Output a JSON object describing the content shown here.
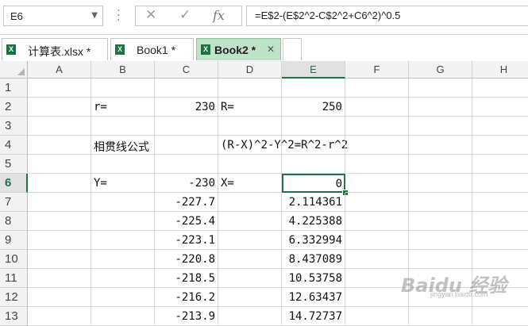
{
  "formula_bar": {
    "name_box": "E6",
    "name_box_icon": "chevron-down-icon",
    "cancel_icon": "✕",
    "enter_icon": "✓",
    "fx_icon": "fx",
    "formula": "=E$2-(E$2^2-C$2^2+C6^2)^0.5"
  },
  "tabs": [
    {
      "label": "计算表.xlsx *",
      "icon": "X"
    },
    {
      "label": "Book1 *",
      "icon": "X"
    },
    {
      "label": "Book2 *",
      "icon": "X",
      "active": true,
      "close": "✕"
    }
  ],
  "sheet": {
    "columns": [
      "A",
      "B",
      "C",
      "D",
      "E",
      "F",
      "G",
      "H"
    ],
    "selected_column": "E",
    "rows": [
      "1",
      "2",
      "3",
      "4",
      "5",
      "6",
      "7",
      "8",
      "9",
      "10",
      "11",
      "12",
      "13"
    ],
    "selected_row": "6",
    "active_cell": "E6",
    "cells": {
      "B2": "r=",
      "C2": "230",
      "D2": "R=",
      "E2": "250",
      "B4": "相贯线公式",
      "D4": "(R-X)^2-Y^2=R^2-r^2",
      "B6": "Y=",
      "C6": "-230",
      "D6": "X=",
      "E6": "0",
      "C7": "-227.7",
      "E7": "2.114361",
      "C8": "-225.4",
      "E8": "4.225388",
      "C9": "-223.1",
      "E9": "6.332994",
      "C10": "-220.8",
      "E10": "8.437089",
      "C11": "-218.5",
      "E11": "10.53758",
      "C12": "-216.2",
      "E12": "12.63437",
      "C13": "-213.9",
      "E13": "14.72737"
    }
  },
  "watermark": {
    "text": "Baidu 经验",
    "sub": "jingyan.baidu.com"
  }
}
